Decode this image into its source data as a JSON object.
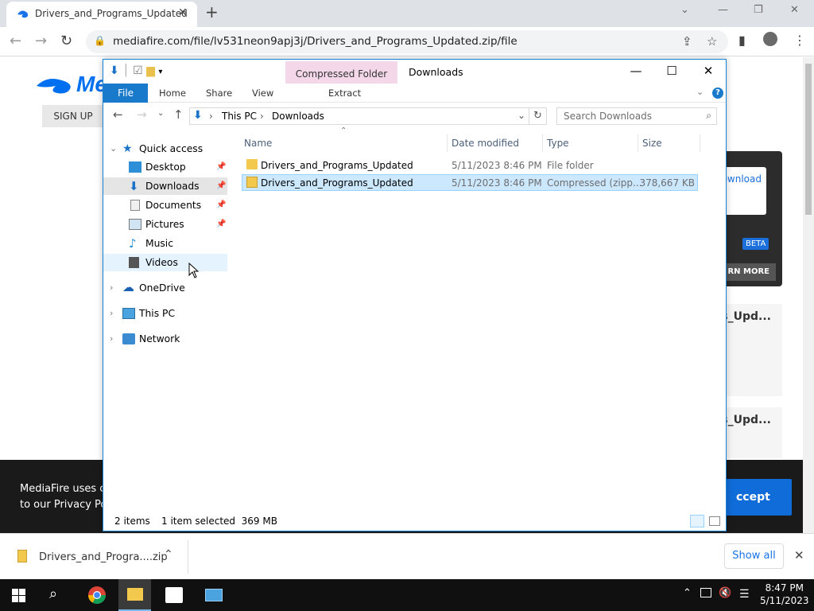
{
  "browser": {
    "tab_title": "Drivers_and_Programs_Updated",
    "url": "mediafire.com/file/lv531neon9apj3j/Drivers_and_Programs_Updated.zip/file"
  },
  "page": {
    "logo_text": "Me",
    "signup": "SIGN UP",
    "download_btn": "ownload",
    "beta": "BETA",
    "learn_more": "RN MORE",
    "card1": "s_Upd...",
    "card2": "s_Upd...",
    "cookie_line1": "MediaFire uses co",
    "cookie_line2": "to our Privacy Poli",
    "accept": "ccept"
  },
  "explorer": {
    "context_tab": "Compressed Folder Tools",
    "window_title": "Downloads",
    "ribbon_tabs": {
      "file": "File",
      "home": "Home",
      "share": "Share",
      "view": "View",
      "extract": "Extract"
    },
    "breadcrumb": {
      "this_pc": "This PC",
      "downloads": "Downloads"
    },
    "search_placeholder": "Search Downloads",
    "nav": {
      "quick_access": "Quick access",
      "desktop": "Desktop",
      "downloads": "Downloads",
      "documents": "Documents",
      "pictures": "Pictures",
      "music": "Music",
      "videos": "Videos",
      "onedrive": "OneDrive",
      "this_pc": "This PC",
      "network": "Network"
    },
    "columns": {
      "name": "Name",
      "date": "Date modified",
      "type": "Type",
      "size": "Size"
    },
    "files": [
      {
        "name": "Drivers_and_Programs_Updated",
        "date": "5/11/2023 8:46 PM",
        "type": "File folder",
        "size": ""
      },
      {
        "name": "Drivers_and_Programs_Updated",
        "date": "5/11/2023 8:46 PM",
        "type": "Compressed (zipp...",
        "size": "378,667 KB"
      }
    ],
    "status": {
      "items": "2 items",
      "selected": "1 item selected  369 MB"
    }
  },
  "downloads_bar": {
    "file": "Drivers_and_Progra....zip",
    "show_all": "Show all"
  },
  "taskbar": {
    "time": "8:47 PM",
    "date": "5/11/2023"
  }
}
